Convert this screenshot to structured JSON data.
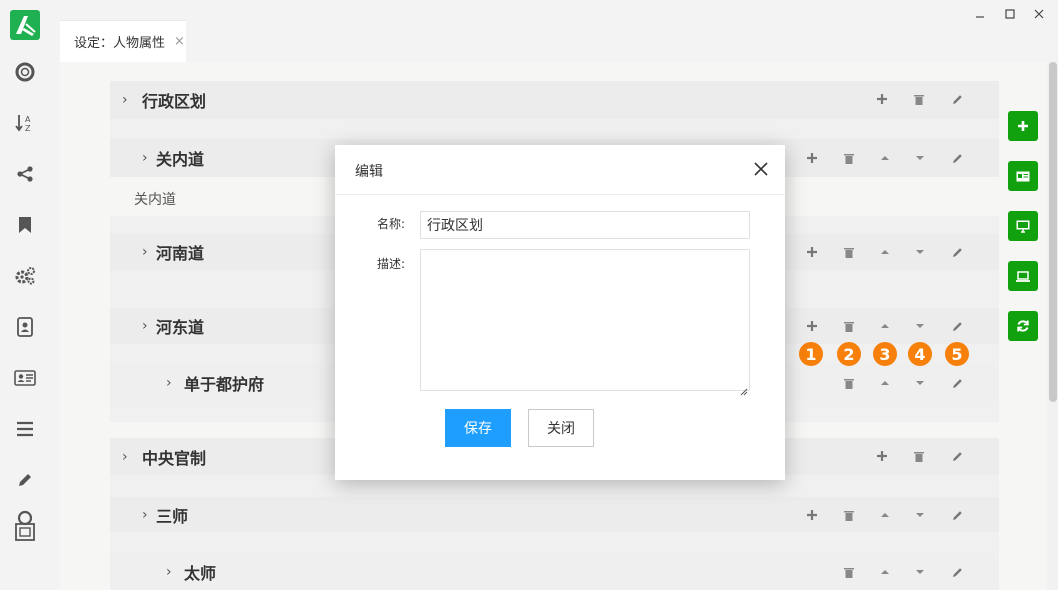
{
  "window": {
    "tab_label": "设定：人物属性",
    "tab_close": "×"
  },
  "sidebar": {
    "icons": [
      "logo-icon",
      "lifebuoy-icon",
      "sort-az-icon",
      "share-icon",
      "bookmark-icon",
      "gears-icon",
      "contact-book-icon",
      "id-card-icon",
      "list-icon",
      "pencil-icon",
      "map-frame-icon"
    ]
  },
  "tree": {
    "rows": [
      {
        "title": "行政区划",
        "chev": "›"
      },
      {
        "title": "关内道",
        "chev": "›",
        "desc": "关内道"
      },
      {
        "title": "河南道",
        "chev": "›"
      },
      {
        "title": "河东道",
        "chev": "›"
      },
      {
        "title": "单于都护府",
        "chev": "›"
      },
      {
        "title": "中央官制",
        "chev": "›"
      },
      {
        "title": "三师",
        "chev": "›"
      },
      {
        "title": "太师",
        "chev": "›"
      }
    ]
  },
  "annotations": [
    "1",
    "2",
    "3",
    "4",
    "5"
  ],
  "modal": {
    "title": "编辑",
    "name_label": "名称:",
    "name_value": "行政区划",
    "desc_label": "描述:",
    "desc_value": "",
    "save_label": "保存",
    "close_label": "关闭"
  },
  "colors": {
    "accent_green": "#11a10f",
    "save_blue": "#1e9fff",
    "badge_orange": "#f7800a"
  }
}
